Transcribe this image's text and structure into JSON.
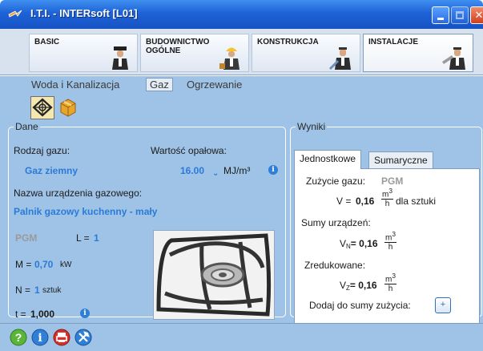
{
  "window": {
    "title": "I.T.I. - INTERsoft [L01]"
  },
  "modules": [
    {
      "label": "BASIC"
    },
    {
      "label": "BUDOWNICTWO\nOGÓLNE"
    },
    {
      "label": "KONSTRUKCJA"
    },
    {
      "label": "INSTALACJE"
    }
  ],
  "subnav": [
    "Woda i Kanalizacja",
    "Gaz",
    "Ogrzewanie"
  ],
  "dane": {
    "legend": "Dane",
    "gas_type_label": "Rodzaj gazu:",
    "gas_type_value": "Gaz ziemny",
    "calorific_label": "Wartość opałowa:",
    "calorific_value": "16.00",
    "calorific_unit": "MJ/m³",
    "device_name_label": "Nazwa urządzenia gazowego:",
    "device_name_value": "Palnik gazowy kuchenny - mały",
    "code": "PGM",
    "l_label": "L =",
    "l_value": "1",
    "m_label": "M =",
    "m_value": "0,70",
    "m_unit": "kW",
    "n_label": "N =",
    "n_value": "1",
    "n_unit": "sztuk",
    "t_label": "t =",
    "t_value": "1,000"
  },
  "wyniki": {
    "legend": "Wyniki",
    "tabs": [
      "Jednostkowe",
      "Sumaryczne"
    ],
    "consumption_label": "Zużycie gazu:",
    "consumption_code": "PGM",
    "v_symbol": "V =",
    "v_value": "0,16",
    "unit_num": "m",
    "unit_exp": "3",
    "unit_den": "h",
    "v_suffix": "dla sztuki",
    "sums_label": "Sumy urządzeń:",
    "vn_symbol": "V",
    "vn_sub": "N",
    "vn_value": "= 0,16",
    "reduced_label": "Zredukowane:",
    "vz_symbol": "V",
    "vz_sub": "Z",
    "vz_value": "= 0,16",
    "add_label": "Dodaj do sumy zużycia:",
    "add_button": "+"
  },
  "icons": {
    "toolbar": [
      "gas-burner-icon",
      "box-icon"
    ],
    "bottom": [
      "help-icon",
      "info-icon",
      "print-icon",
      "settings-icon"
    ]
  }
}
